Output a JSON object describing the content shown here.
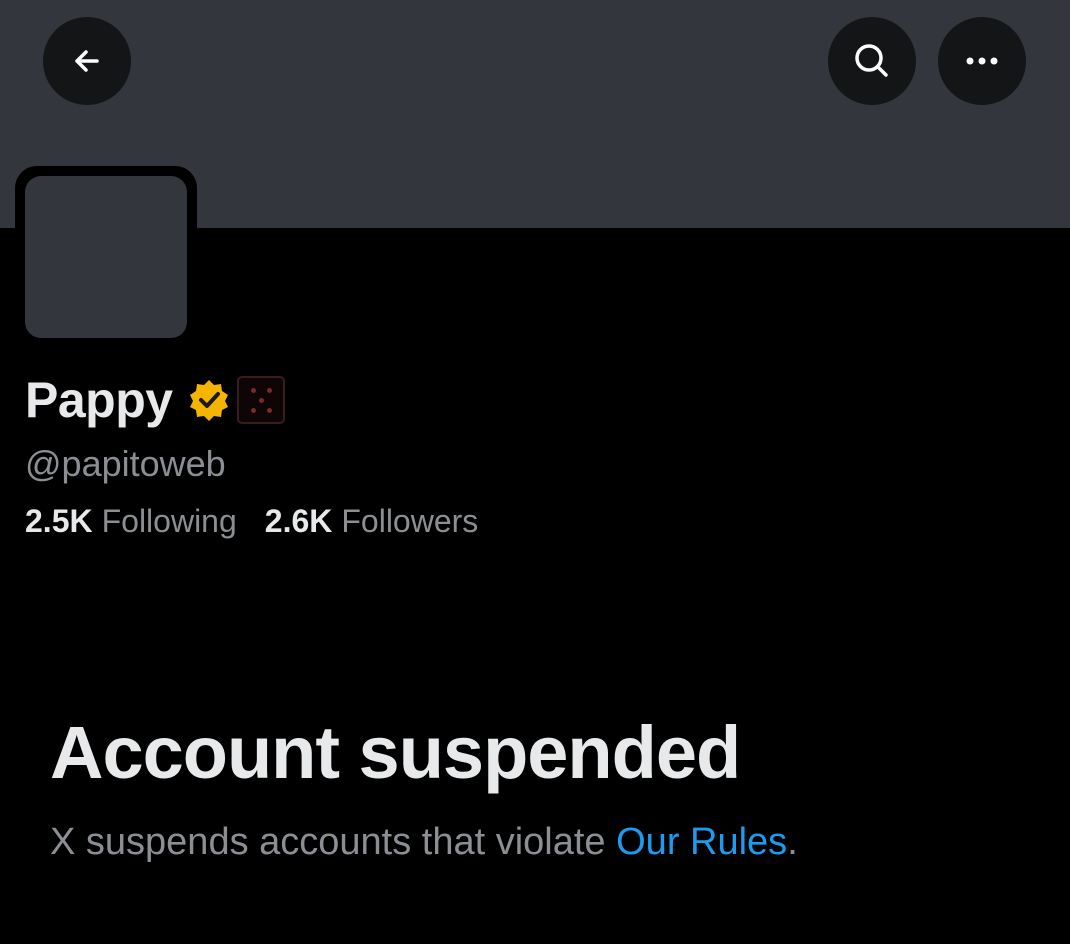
{
  "header": {
    "back_icon": "arrow-left-icon",
    "search_icon": "search-icon",
    "more_icon": "more-horizontal-icon"
  },
  "profile": {
    "display_name": "Pappy",
    "verified_badge_icon": "verified-check-badge-icon",
    "verified_badge_color": "#f4b400",
    "affiliate_badge_icon": "affiliate-badge-icon",
    "handle": "@papitoweb",
    "stats": {
      "following_count": "2.5K",
      "following_label": "Following",
      "followers_count": "2.6K",
      "followers_label": "Followers"
    }
  },
  "suspension": {
    "title": "Account suspended",
    "message_prefix": "X suspends accounts that violate ",
    "rules_link": "Our Rules",
    "message_suffix": "."
  },
  "colors": {
    "background": "#000000",
    "banner": "#33363c",
    "button_bg": "#141517",
    "text_primary": "#e7e9ea",
    "text_secondary": "#8b8f94",
    "link": "#1d9bf0"
  }
}
